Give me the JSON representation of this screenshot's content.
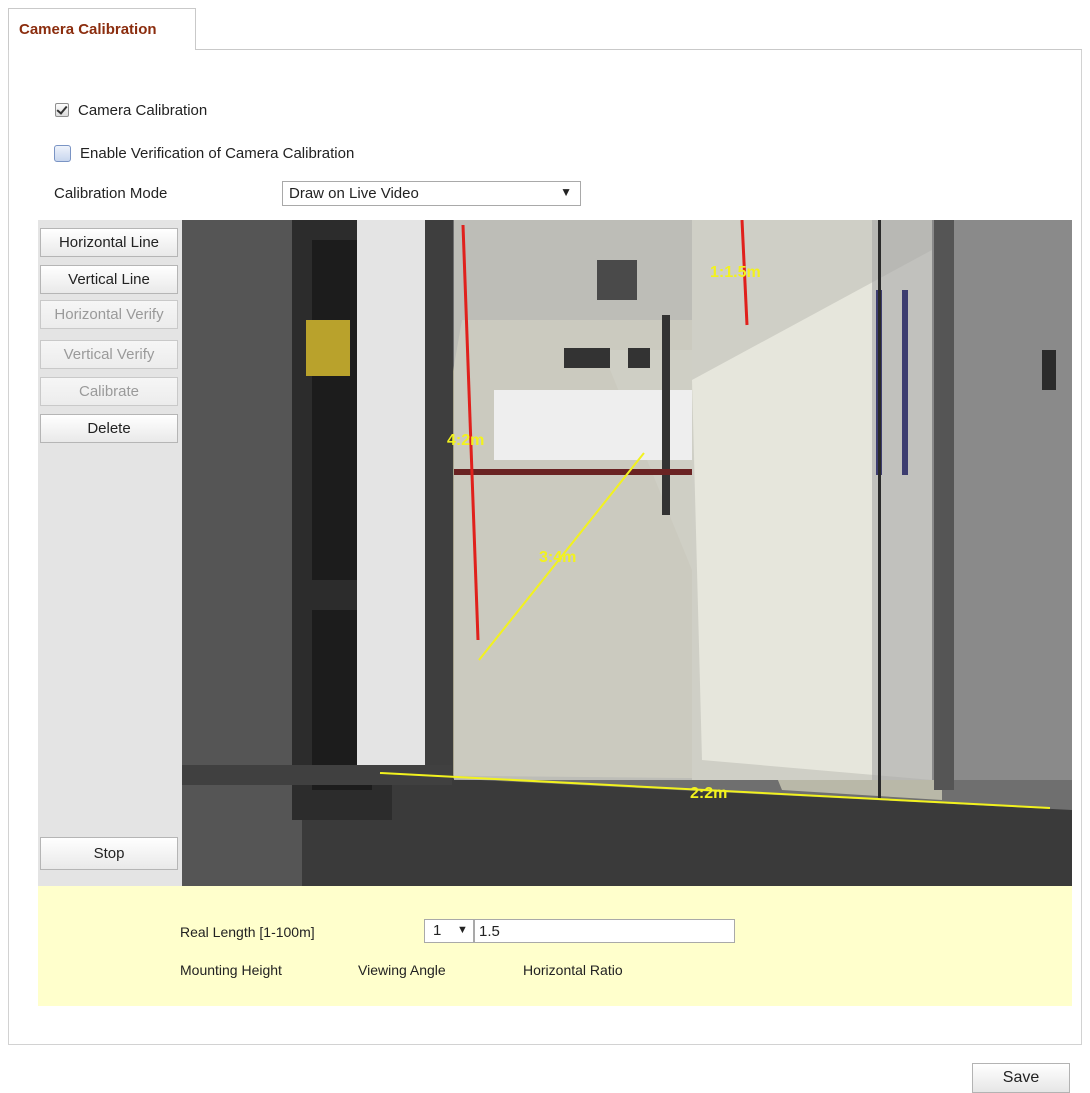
{
  "tab": {
    "label": "Camera Calibration"
  },
  "options": {
    "camera_calibration": {
      "label": "Camera Calibration",
      "checked": true
    },
    "enable_verification": {
      "label": "Enable Verification of Camera Calibration",
      "checked": false
    }
  },
  "calibration_mode": {
    "label": "Calibration Mode",
    "value": "Draw on Live Video"
  },
  "tools": {
    "horizontal_line": "Horizontal Line",
    "vertical_line": "Vertical Line",
    "horizontal_verify": "Horizontal Verify",
    "vertical_verify": "Vertical Verify",
    "calibrate": "Calibrate",
    "delete": "Delete",
    "stop": "Stop"
  },
  "video": {
    "line_labels": {
      "vertical_1": "1:1.5m",
      "horizontal_2": "2:2m",
      "horizontal_3": "3:4m",
      "vertical_4": "4:2m"
    },
    "colors": {
      "vertical_line": "#e0201c",
      "horizontal_line": "#f2f21e",
      "label": "#f2f21e"
    }
  },
  "params": {
    "real_length_label": "Real Length [1-100m]",
    "line_index": "1",
    "real_length_value": "1.5",
    "mounting_height_label": "Mounting Height",
    "viewing_angle_label": "Viewing Angle",
    "horizontal_ratio_label": "Horizontal Ratio"
  },
  "save_label": "Save"
}
